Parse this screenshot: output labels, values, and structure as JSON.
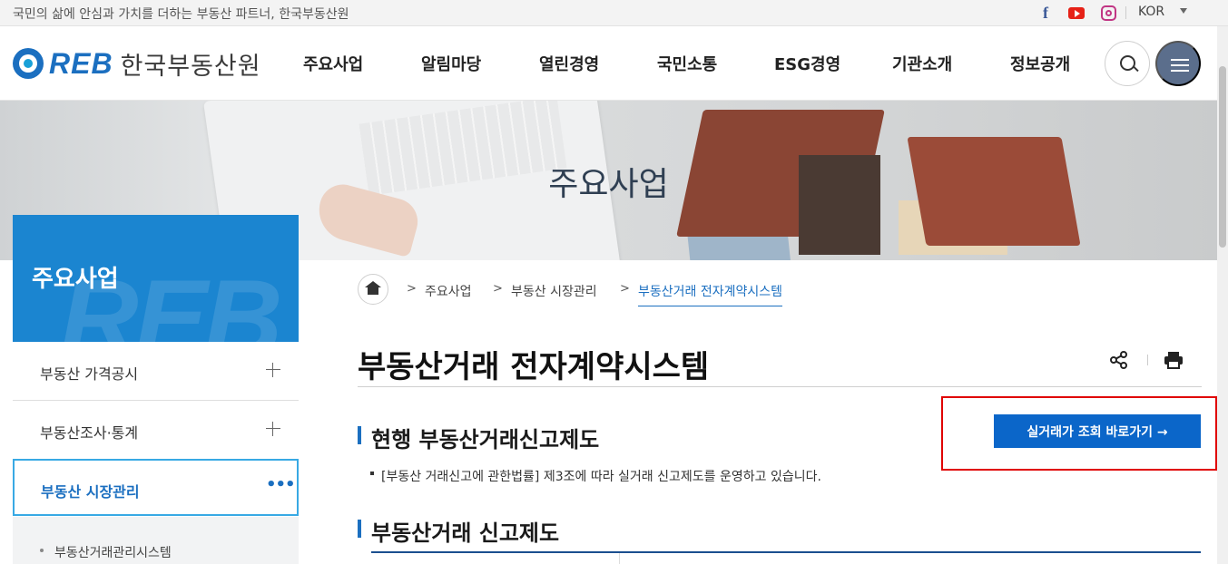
{
  "topbar": {
    "slogan": "국민의 삶에 안심과 가치를 더하는 부동산 파트너, 한국부동산원",
    "facebook_glyph": "f",
    "lang": "KOR",
    "icons": [
      "facebook-icon",
      "youtube-icon",
      "instagram-icon",
      "chevron-down-icon"
    ]
  },
  "header": {
    "logo_mark": "REB",
    "logo_name": "한국부동산원",
    "nav": [
      "주요사업",
      "알림마당",
      "열린경영",
      "국민소통",
      "ESG경영",
      "기관소개",
      "정보공개"
    ],
    "icons": [
      "search-icon",
      "hamburger-menu-icon"
    ]
  },
  "hero": {
    "title": "주요사업"
  },
  "sidebar": {
    "title": "주요사업",
    "watermark": "REB",
    "items": [
      {
        "label": "부동산 가격공시",
        "expander": "plus-icon"
      },
      {
        "label": "부동산조사·통계",
        "expander": "plus-icon"
      },
      {
        "label": "부동산 시장관리",
        "expander": "more-icon",
        "active": true
      }
    ],
    "more_glyph": "•••",
    "sub_items": [
      {
        "label": "부동산거래관리시스템"
      }
    ]
  },
  "breadcrumb": {
    "home_icon": "home-icon",
    "separator": ">",
    "items": [
      "주요사업",
      "부동산 시장관리",
      "부동산거래 전자계약시스템"
    ]
  },
  "page": {
    "title": "부동산거래 전자계약시스템",
    "tool_icons": [
      "share-icon",
      "print-icon"
    ]
  },
  "content": {
    "section1_title": "현행 부동산거래신고제도",
    "section1_desc": "[부동산 거래신고에 관한법률] 제3조에 따라 실거래 신고제도를 운영하고 있습니다.",
    "cta_label": "실거래가 조회 바로가기 →",
    "section2_title": "부동산거래 신고제도"
  },
  "colors": {
    "brand": "#1b6fc0",
    "sidebar_head": "#1b85d0",
    "cta": "#0b66c9",
    "highlight_border": "#e00000",
    "menu_button": "#5b6e8c"
  }
}
